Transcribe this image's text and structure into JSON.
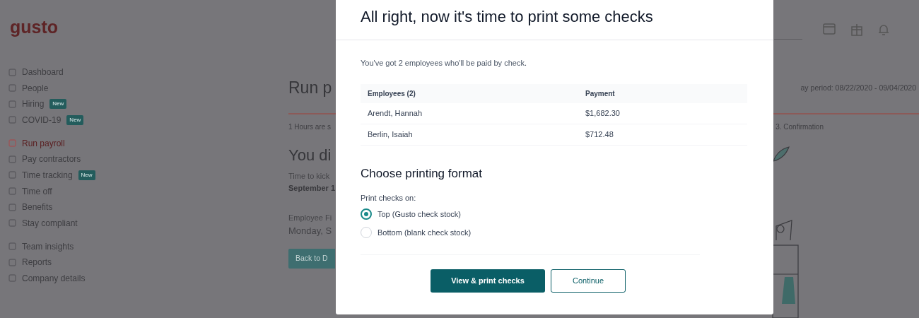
{
  "logo": "gusto",
  "sidebar": {
    "groups": [
      {
        "items": [
          {
            "label": "Dashboard",
            "selected": false
          },
          {
            "label": "People",
            "selected": false
          },
          {
            "label": "Hiring",
            "badge": "New",
            "selected": false
          },
          {
            "label": "COVID-19",
            "badge": "New",
            "selected": false
          }
        ]
      },
      {
        "items": [
          {
            "label": "Run payroll",
            "selected": true
          },
          {
            "label": "Pay contractors",
            "selected": false
          },
          {
            "label": "Time tracking",
            "badge": "New",
            "selected": false
          },
          {
            "label": "Time off",
            "selected": false
          },
          {
            "label": "Benefits",
            "selected": false
          },
          {
            "label": "Stay compliant",
            "selected": false
          }
        ]
      },
      {
        "items": [
          {
            "label": "Team insights",
            "selected": false
          },
          {
            "label": "Reports",
            "selected": false
          },
          {
            "label": "Company details",
            "selected": false
          }
        ]
      }
    ]
  },
  "main": {
    "title": "Run p",
    "pay_period": "ay period: 08/22/2020 - 09/04/2020",
    "step_note": "1 Hours are s",
    "step": "3. Confirmation",
    "heading": "You di",
    "message": "Time to kick",
    "message_date": "September 1",
    "deadline_label": "Employee Fi",
    "deadline_value": "Monday, S",
    "back_button": "Back to D"
  },
  "modal": {
    "title": "All right, now it's time to print some checks",
    "intro": "You've got 2 employees who'll be paid by check.",
    "table": {
      "columns": [
        "Employees (2)",
        "Payment"
      ],
      "rows": [
        [
          "Arendt, Hannah",
          "$1,682.30"
        ],
        [
          "Berlin, Isaiah",
          "$712.48"
        ]
      ]
    },
    "format_heading": "Choose printing format",
    "format_label": "Print checks on:",
    "options": [
      {
        "label": "Top (Gusto check stock)",
        "selected": true
      },
      {
        "label": "Bottom (blank check stock)",
        "selected": false
      }
    ],
    "buttons": [
      {
        "label": "View & print checks",
        "kind": "primary"
      },
      {
        "label": "Continue",
        "kind": "secondary"
      }
    ]
  }
}
